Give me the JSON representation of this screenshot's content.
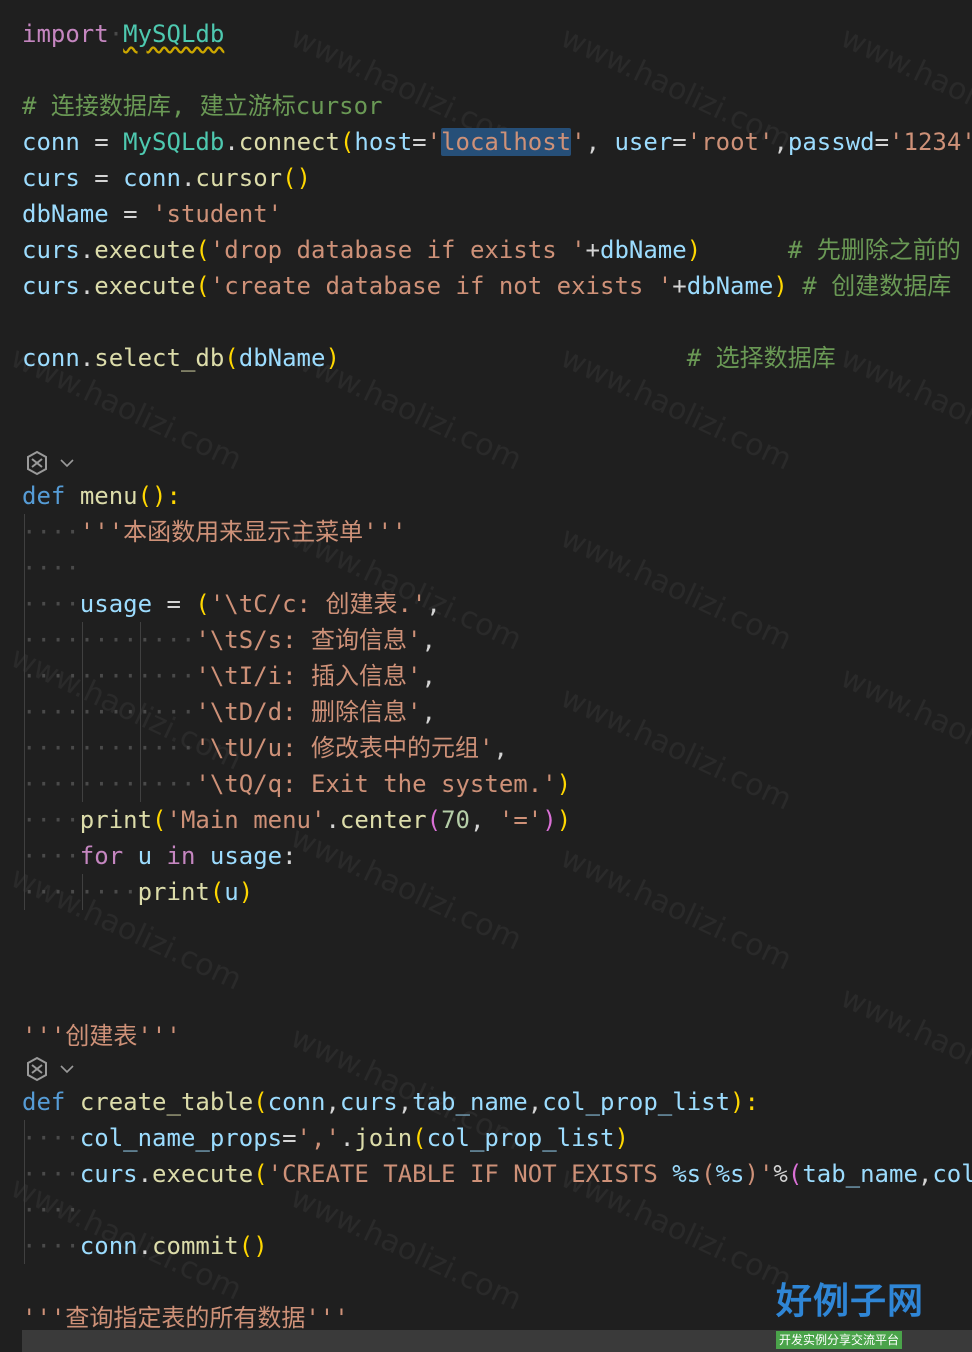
{
  "editor": {
    "lines": {
      "l1": {
        "kw": "import",
        "mod": "MySQLdb"
      },
      "l2": {
        "comment": "# 连接数据库, 建立游标cursor"
      },
      "l3": {
        "a": "conn",
        "b": " = ",
        "c": "MySQLdb",
        "d": ".",
        "e": "connect",
        "f": "(",
        "g": "host",
        "h": "=",
        "i": "'",
        "j": "localhost",
        "k": "'",
        "l": ", ",
        "m": "user",
        "n": "=",
        "o": "'root'",
        "p": ",",
        "q": "passwd",
        "r": "=",
        "s": "'1234'"
      },
      "l4": {
        "a": "curs",
        "b": " = ",
        "c": "conn",
        "d": ".",
        "e": "cursor",
        "f": "()"
      },
      "l5": {
        "a": "dbName",
        "b": " = ",
        "c": "'student'"
      },
      "l6": {
        "a": "curs",
        "b": ".",
        "c": "execute",
        "d": "(",
        "e": "'drop database if exists '",
        "f": "+",
        "g": "dbName",
        "h": ")",
        "i": "      ",
        "j": "# 先删除之前的"
      },
      "l7": {
        "a": "curs",
        "b": ".",
        "c": "execute",
        "d": "(",
        "e": "'create database if not exists '",
        "f": "+",
        "g": "dbName",
        "h": ")",
        "i": " ",
        "j": "# 创建数据库"
      },
      "l8": {
        "a": "conn",
        "b": ".",
        "c": "select_db",
        "d": "(",
        "e": "dbName",
        "f": ")",
        "g": "                        ",
        "h": "# 选择数据库"
      },
      "l9": {
        "a": "def",
        "b": " ",
        "c": "menu",
        "d": "():"
      },
      "l10": {
        "a": "'''本函数用来显示主菜单'''"
      },
      "l11": {
        "a": "usage",
        "b": " = ",
        "c": "(",
        "d": "'\\tC/c: 创建表.'",
        "e": ","
      },
      "l12": {
        "a": "'\\tS/s: 查询信息'",
        "b": ","
      },
      "l13": {
        "a": "'\\tI/i: 插入信息'",
        "b": ","
      },
      "l14": {
        "a": "'\\tD/d: 删除信息'",
        "b": ","
      },
      "l15": {
        "a": "'\\tU/u: 修改表中的元组'",
        "b": ","
      },
      "l16": {
        "a": "'\\tQ/q: Exit the system.'",
        "b": ")"
      },
      "l17": {
        "a": "print",
        "b": "(",
        "c": "'Main menu'",
        "d": ".",
        "e": "center",
        "f": "(",
        "g": "70",
        "h": ", ",
        "i": "'='",
        "j": ")",
        "k": ")"
      },
      "l18": {
        "a": "for",
        "b": " ",
        "c": "u",
        "d": " ",
        "e": "in",
        "f": " ",
        "g": "usage",
        "h": ":"
      },
      "l19": {
        "a": "print",
        "b": "(",
        "c": "u",
        "d": ")"
      },
      "l20": {
        "a": "'''创建表'''"
      },
      "l21": {
        "a": "def",
        "b": " ",
        "c": "create_table",
        "d": "(",
        "e": "conn",
        "f": ",",
        "g": "curs",
        "h": ",",
        "i": "tab_name",
        "j": ",",
        "k": "col_prop_list",
        "l": "):"
      },
      "l22": {
        "a": "col_name_props",
        "b": "=",
        "c": "','",
        "d": ".",
        "e": "join",
        "f": "(",
        "g": "col_prop_list",
        "h": ")"
      },
      "l23": {
        "a": "curs",
        "b": ".",
        "c": "execute",
        "d": "(",
        "e": "'CREATE TABLE IF NOT EXISTS ",
        "f": "%s",
        "g": "(",
        "h": "%s",
        "i": ")'",
        "j": "%",
        "k": "(",
        "l": "tab_name",
        "m": ",",
        "n": "col"
      },
      "l24": {
        "a": "conn",
        "b": ".",
        "c": "commit",
        "d": "()"
      },
      "l25": {
        "a": "'''查询指定表的所有数据'''"
      }
    }
  },
  "watermark": {
    "text": "www.haolizi.com"
  },
  "logo": {
    "main": "好例子网",
    "sub": "开发实例分享交流平台"
  },
  "colors": {
    "background": "#1f1f1f",
    "keyword": "#c586c0",
    "def": "#569cd6",
    "variable": "#9cdcfe",
    "function": "#dcdcaa",
    "string": "#ce9178",
    "comment": "#6a9955",
    "module": "#4ec9b0",
    "logo_blue": "#2f86d6",
    "logo_green": "#4aa34a"
  },
  "icons": {
    "codelens": "copilot-sparkle-icon",
    "chevron": "chevron-down-icon"
  }
}
